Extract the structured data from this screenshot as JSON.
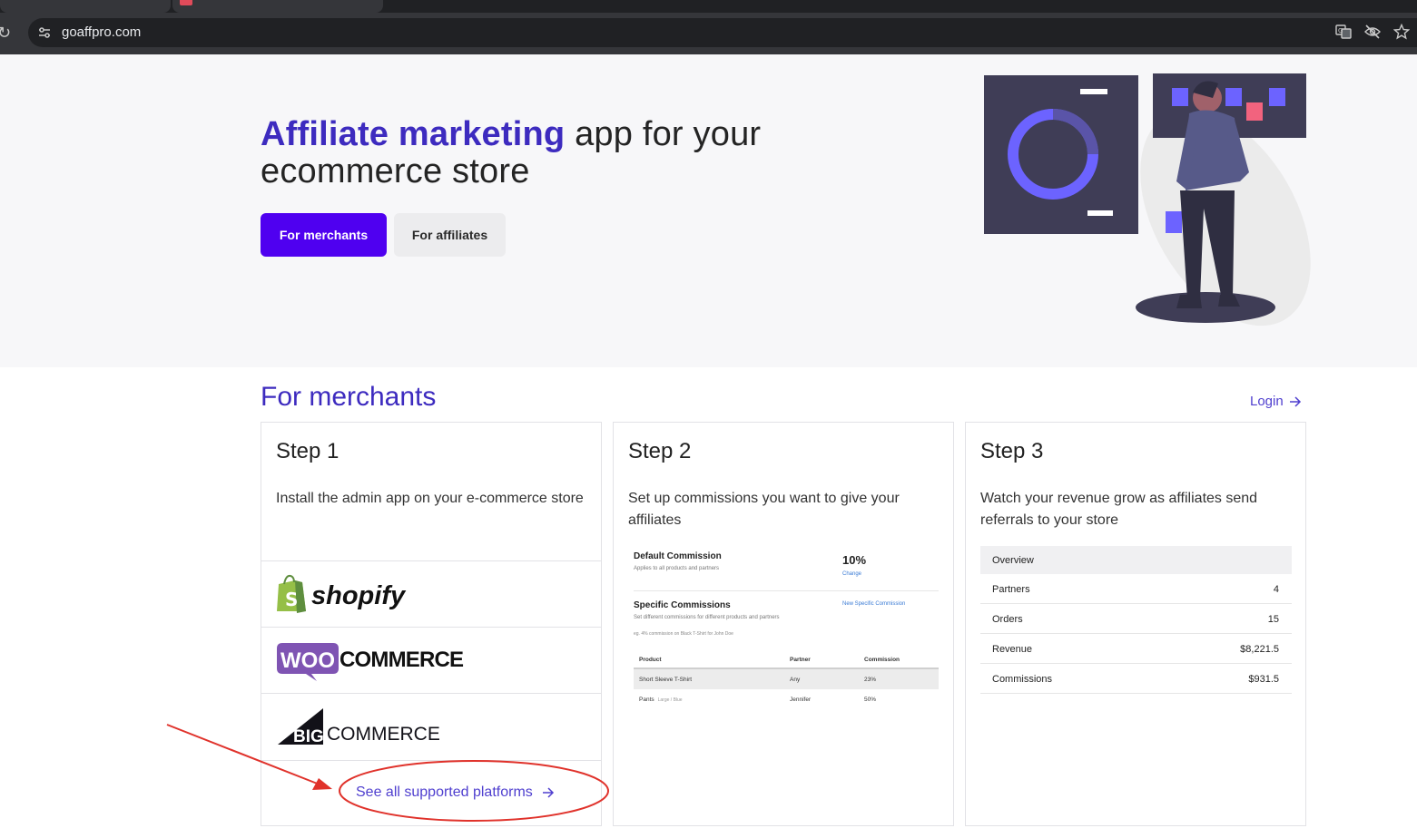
{
  "browser": {
    "url": "goaffpro.com"
  },
  "hero": {
    "title_accent": "Affiliate marketing",
    "title_rest": " app for your ecommerce store",
    "btn_merchants": "For merchants",
    "btn_affiliates": "For affiliates"
  },
  "merchants": {
    "section_title": "For merchants",
    "login_label": "Login",
    "steps": [
      {
        "title": "Step 1",
        "description": "Install the admin app on your e-commerce store",
        "platforms": [
          "shopify",
          "COMMERCE",
          "COMMERCE"
        ],
        "see_all_label": "See all supported platforms"
      },
      {
        "title": "Step 2",
        "description": "Set up commissions you want to give your affiliates"
      },
      {
        "title": "Step 3",
        "description": "Watch your revenue grow as affiliates send referrals to your store"
      }
    ]
  },
  "commission_preview": {
    "default_title": "Default Commission",
    "default_sub": "Applies to all products and partners",
    "default_value": "10%",
    "change_label": "Change",
    "specific_title": "Specific Commissions",
    "specific_sub": "Set different commissions for different products and partners",
    "specific_eg": "eg. 4% commission on Black T-Shirt for John Doe",
    "new_label": "New Specific Commission",
    "columns": [
      "Product",
      "Partner",
      "Commission"
    ],
    "rows": [
      {
        "product": "Short Sleeve T-Shirt",
        "variant": "",
        "partner": "Any",
        "commission": "23%"
      },
      {
        "product": "Pants",
        "variant": "Large / Blue",
        "partner": "Jennifer",
        "commission": "50%"
      }
    ]
  },
  "overview_preview": {
    "header": "Overview",
    "rows": [
      {
        "label": "Partners",
        "value": "4"
      },
      {
        "label": "Orders",
        "value": "15"
      },
      {
        "label": "Revenue",
        "value": "$8,221.5"
      },
      {
        "label": "Commissions",
        "value": "$931.5"
      }
    ]
  },
  "logos": {
    "woo_mark": "WOO",
    "big_mark": "BIG"
  },
  "colors": {
    "accent": "#3d2bbf",
    "primary_button": "#4f00f0",
    "link": "#4f3fcf",
    "annotation": "#e0322b"
  }
}
